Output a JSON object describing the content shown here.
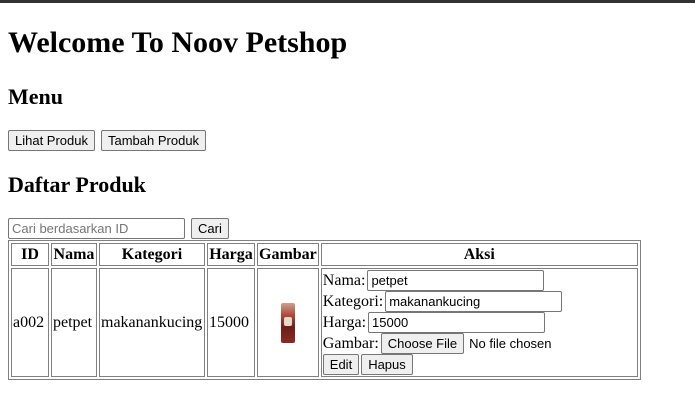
{
  "page": {
    "title": "Welcome To Noov Petshop",
    "menu_heading": "Menu",
    "list_heading": "Daftar Produk"
  },
  "menu": {
    "view_products_label": "Lihat Produk",
    "add_product_label": "Tambah Produk"
  },
  "search": {
    "placeholder": "Cari berdasarkan ID",
    "button_label": "Cari"
  },
  "table": {
    "headers": [
      "ID",
      "Nama",
      "Kategori",
      "Harga",
      "Gambar",
      "Aksi"
    ],
    "rows": [
      {
        "id": "a002",
        "nama": "petpet",
        "kategori": "makanankucing",
        "harga": "15000",
        "form": {
          "nama_label": "Nama:",
          "nama_value": "petpet",
          "kategori_label": "Kategori:",
          "kategori_value": "makanankucing",
          "harga_label": "Harga:",
          "harga_value": "15000",
          "gambar_label": "Gambar:",
          "file_button": "Choose File",
          "file_status": "No file chosen",
          "edit_label": "Edit",
          "delete_label": "Hapus"
        }
      }
    ]
  },
  "icons": {
    "product_image": "cat-food-bag-image"
  }
}
